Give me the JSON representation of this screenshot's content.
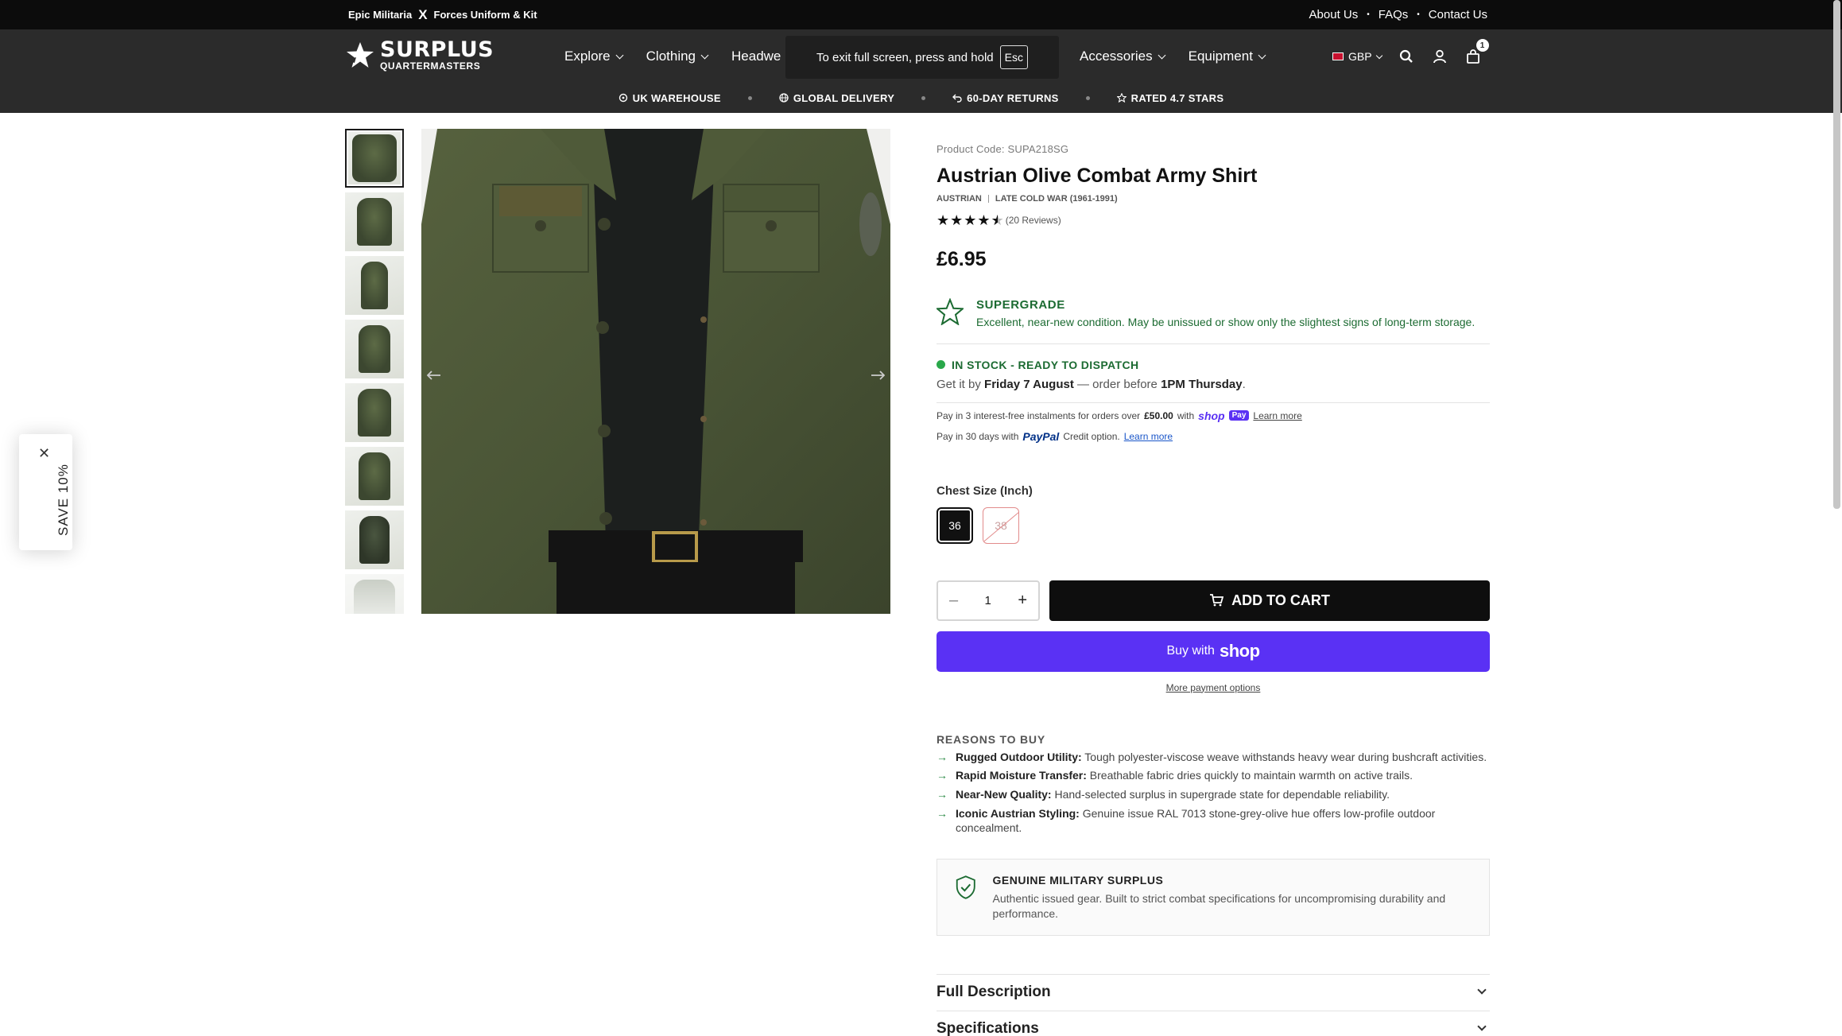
{
  "announcement": {
    "left_brand": "Epic Militaria",
    "left_x": "X",
    "left_tail": "Forces Uniform & Kit",
    "links": [
      "About Us",
      "FAQs",
      "Contact Us"
    ],
    "separator": "•"
  },
  "header": {
    "logo_line1": "SURPLUS",
    "logo_line2": "QUARTERMASTERS",
    "nav": [
      {
        "label": "Explore"
      },
      {
        "label": "Clothing"
      },
      {
        "label": "Headwe"
      }
    ],
    "nav_right": [
      {
        "label": "Accessories"
      },
      {
        "label": "Equipment"
      }
    ],
    "fullscreen_toast": {
      "text": "To exit full screen, press and hold",
      "key": "Esc"
    },
    "currency": "GBP",
    "cart_count": "1",
    "usps": [
      {
        "label": "UK WAREHOUSE",
        "icon": "warehouse-icon"
      },
      {
        "label": "GLOBAL DELIVERY",
        "icon": "globe-icon"
      },
      {
        "label": "60-DAY RETURNS",
        "icon": "return-icon"
      },
      {
        "label": "RATED 4.7 STARS",
        "icon": "star-icon"
      }
    ]
  },
  "gallery": {
    "thumbnail_count": 8,
    "active_index": 0
  },
  "product": {
    "code_label": "Product Code: SUPA218SG",
    "title": "Austrian Olive Combat Army Shirt",
    "origin": "AUSTRIAN",
    "era": "LATE COLD WAR (1961-1991)",
    "rating": 4.5,
    "reviews": "(20 Reviews)",
    "price": "£6.95",
    "grade_title": "SUPERGRADE",
    "grade_desc": "Excellent, near-new condition. May be unissued or show only the slightest signs of long-term storage.",
    "stock": "IN STOCK - READY TO DISPATCH",
    "delivery_prefix": "Get it by",
    "delivery_date": "Friday 7 August",
    "delivery_mid": "— order before",
    "delivery_time": "1PM Thursday",
    "delivery_end": ".",
    "shop_pay_text1": "Pay in 3 interest-free instalments for orders over",
    "shop_pay_amount": "£50.00",
    "shop_pay_with": "with",
    "shop_word": "shop",
    "shop_pay_badge": "Pay",
    "learn_more": "Learn more",
    "paypal_text1": "Pay in 30 days with",
    "paypal_word": "PayPal",
    "paypal_text2": "Credit option.",
    "size_label": "Chest Size (Inch)",
    "sizes": [
      {
        "label": "36",
        "state": "selected"
      },
      {
        "label": "38",
        "state": "unavailable"
      }
    ],
    "quantity": "1",
    "qty_minus": "–",
    "qty_plus": "+",
    "add_to_cart": "ADD TO CART",
    "buy_with": "Buy with",
    "buy_shop": "shop",
    "more_payment": "More payment options",
    "reasons_title": "REASONS TO BUY",
    "reasons": [
      {
        "bold": "Rugged Outdoor Utility:",
        "text": " Tough polyester-viscose weave withstands heavy wear during bushcraft activities."
      },
      {
        "bold": "Rapid Moisture Transfer:",
        "text": " Breathable fabric dries quickly to maintain warmth on active trails."
      },
      {
        "bold": "Near-New Quality:",
        "text": " Hand-selected surplus in supergrade state for dependable reliability."
      },
      {
        "bold": "Iconic Austrian Styling:",
        "text": " Genuine issue RAL 7013 stone-grey-olive hue offers low-profile outdoor concealment."
      }
    ],
    "genuine_title": "GENUINE MILITARY SURPLUS",
    "genuine_desc": "Authentic issued gear. Built to strict combat specifications for uncompromising durability and performance.",
    "accordion": [
      "Full Description",
      "Specifications"
    ]
  },
  "side_tab": {
    "label": "SAVE 10%",
    "close": "✕"
  },
  "colors": {
    "header_bg": "#2b2b2b",
    "green": "#1c6b32",
    "shop_purple": "#5a31f4"
  }
}
